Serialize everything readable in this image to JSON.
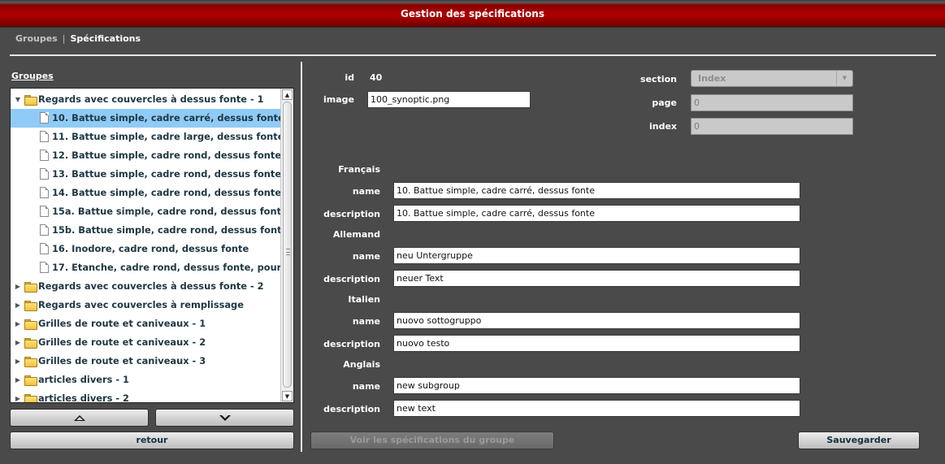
{
  "window": {
    "title": "Gestion des spécifications"
  },
  "nav": {
    "groupes": "Groupes",
    "separator": "|",
    "specifications": "Spécifications"
  },
  "sidebar": {
    "heading": "Groupes",
    "tree": [
      {
        "label": "Regards avec couvercles à dessus fonte - 1",
        "type": "folder",
        "expanded": true,
        "level": 0
      },
      {
        "label": "10. Battue simple, cadre carré, dessus fonte",
        "type": "doc",
        "selected": true,
        "level": 1
      },
      {
        "label": "11. Battue simple, cadre large, dessus fonte",
        "type": "doc",
        "level": 1
      },
      {
        "label": "12. Battue simple, cadre rond, dessus fonte",
        "type": "doc",
        "level": 1
      },
      {
        "label": "13. Battue simple, cadre rond, dessus fonte,",
        "type": "doc",
        "level": 1
      },
      {
        "label": "14. Battue simple, cadre rond, dessus fonte,",
        "type": "doc",
        "level": 1
      },
      {
        "label": "15a. Battue simple, cadre rond, dessus fonte",
        "type": "doc",
        "level": 1
      },
      {
        "label": "15b. Battue simple, cadre rond, dessus fonte",
        "type": "doc",
        "level": 1
      },
      {
        "label": "16. Inodore, cadre rond, dessus fonte",
        "type": "doc",
        "level": 1
      },
      {
        "label": "17. Etanche, cadre rond, dessus fonte, pour p",
        "type": "doc",
        "level": 1
      },
      {
        "label": "Regards avec couvercles à dessus fonte - 2",
        "type": "folder",
        "expanded": false,
        "level": 0
      },
      {
        "label": "Regards avec couvercles à remplissage",
        "type": "folder",
        "expanded": false,
        "level": 0
      },
      {
        "label": "Grilles de route et caniveaux - 1",
        "type": "folder",
        "expanded": false,
        "level": 0
      },
      {
        "label": "Grilles de route et caniveaux - 2",
        "type": "folder",
        "expanded": false,
        "level": 0
      },
      {
        "label": "Grilles de route et caniveaux - 3",
        "type": "folder",
        "expanded": false,
        "level": 0
      },
      {
        "label": "articles divers - 1",
        "type": "folder",
        "expanded": false,
        "level": 0
      },
      {
        "label": "articles divers - 2",
        "type": "folder",
        "expanded": false,
        "level": 0
      }
    ],
    "buttons": {
      "retour": "retour"
    }
  },
  "form": {
    "id_label": "id",
    "id_value": "40",
    "image_label": "image",
    "image_value": "100_synoptic.png",
    "section_label": "section",
    "section_value": "Index",
    "page_label": "page",
    "page_value": "0",
    "index_label": "index",
    "index_value": "0",
    "languages": [
      {
        "heading": "Français",
        "name_label": "name",
        "name_value": "10. Battue simple, cadre carré, dessus fonte",
        "desc_label": "description",
        "desc_value": "10. Battue simple, cadre carré, dessus fonte"
      },
      {
        "heading": "Allemand",
        "name_label": "name",
        "name_value": "neu Untergruppe",
        "desc_label": "description",
        "desc_value": "neuer Text"
      },
      {
        "heading": "Italien",
        "name_label": "name",
        "name_value": "nuovo sottogruppo",
        "desc_label": "description",
        "desc_value": "nuovo testo"
      },
      {
        "heading": "Anglais",
        "name_label": "name",
        "name_value": "new subgroup",
        "desc_label": "description",
        "desc_value": "new text"
      }
    ],
    "buttons": {
      "voir": "Voir les spécifications du groupe",
      "sauvegarder": "Sauvegarder"
    }
  },
  "colors": {
    "titlebar": "#b00000",
    "background": "#4a4a4a",
    "selection": "#8fcbf6",
    "tree_text": "#1e3744"
  }
}
